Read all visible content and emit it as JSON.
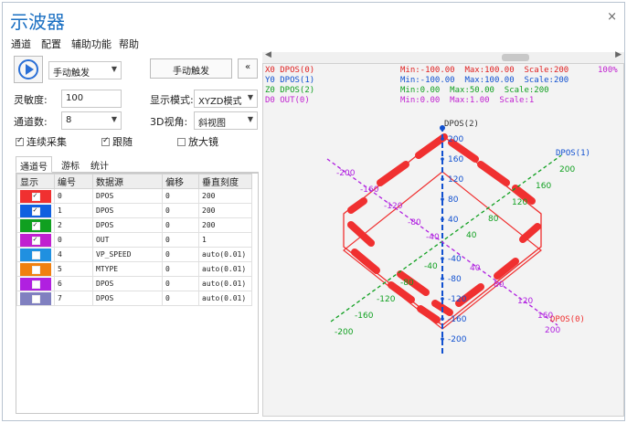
{
  "window": {
    "title": "示波器",
    "close": "×"
  },
  "menu": [
    "通道",
    "配置",
    "辅助功能",
    "帮助"
  ],
  "controls": {
    "trigger_mode": "手动触发",
    "trigger_button": "手动触发",
    "collapse_button": "«",
    "sensitivity_label": "灵敏度:",
    "sensitivity_value": "100",
    "display_mode_label": "显示模式:",
    "display_mode_value": "XYZD模式",
    "channels_label": "通道数:",
    "channels_value": "8",
    "view3d_label": "3D视角:",
    "view3d_value": "斜视图",
    "continuous_label": "连续采集",
    "follow_label": "跟随",
    "magnifier_label": "放大镜"
  },
  "tabs": [
    "通道号",
    "游标",
    "统计"
  ],
  "table": {
    "headers": [
      "显示",
      "编号",
      "数据源",
      "偏移",
      "垂直刻度"
    ],
    "rows": [
      {
        "color": "#f03030",
        "checked": true,
        "id": "0",
        "source": "DPOS",
        "offset": "0",
        "scale": "200"
      },
      {
        "color": "#1060e0",
        "checked": true,
        "id": "1",
        "source": "DPOS",
        "offset": "0",
        "scale": "200"
      },
      {
        "color": "#10a020",
        "checked": true,
        "id": "2",
        "source": "DPOS",
        "offset": "0",
        "scale": "200"
      },
      {
        "color": "#c020d0",
        "checked": true,
        "id": "0",
        "source": "OUT",
        "offset": "0",
        "scale": "1"
      },
      {
        "color": "#2090e0",
        "checked": false,
        "id": "4",
        "source": "VP_SPEED",
        "offset": "0",
        "scale": "auto(0.01)"
      },
      {
        "color": "#f08010",
        "checked": false,
        "id": "5",
        "source": "MTYPE",
        "offset": "0",
        "scale": "auto(0.01)"
      },
      {
        "color": "#b020e0",
        "checked": false,
        "id": "6",
        "source": "DPOS",
        "offset": "0",
        "scale": "auto(0.01)"
      },
      {
        "color": "#8080c0",
        "checked": false,
        "id": "7",
        "source": "DPOS",
        "offset": "0",
        "scale": "auto(0.01)"
      }
    ]
  },
  "plot_legend": [
    {
      "left": "X0 DPOS(0)",
      "right": "Min:-100.00  Max:100.00  Scale:200",
      "color": "#e02020"
    },
    {
      "left": "Y0 DPOS(1)",
      "right": "Min:-100.00  Max:100.00  Scale:200",
      "color": "#1050d0"
    },
    {
      "left": "Z0 DPOS(2)",
      "right": "Min:0.00  Max:50.00  Scale:200",
      "color": "#10a020"
    },
    {
      "left": "D0 OUT(0)",
      "right": "Min:0.00  Max:1.00  Scale:1",
      "color": "#c020d0"
    }
  ],
  "plot_zoom": "100%",
  "axes": {
    "z_name": "DPOS(2)",
    "y_name": "DPOS(1)",
    "x_name": "DPOS(0)",
    "z_ticks": [
      "200",
      "160",
      "120",
      "80",
      "40",
      "-40",
      "-80",
      "-120",
      "-160",
      "-200"
    ],
    "y_ticks": [
      "200",
      "160",
      "120",
      "80",
      "40",
      "-40",
      "-80",
      "-120",
      "-160",
      "-200"
    ],
    "x_ticks": [
      "-200",
      "-160",
      "-120",
      "-80",
      "-40",
      "40",
      "80",
      "120",
      "160",
      "200"
    ]
  }
}
